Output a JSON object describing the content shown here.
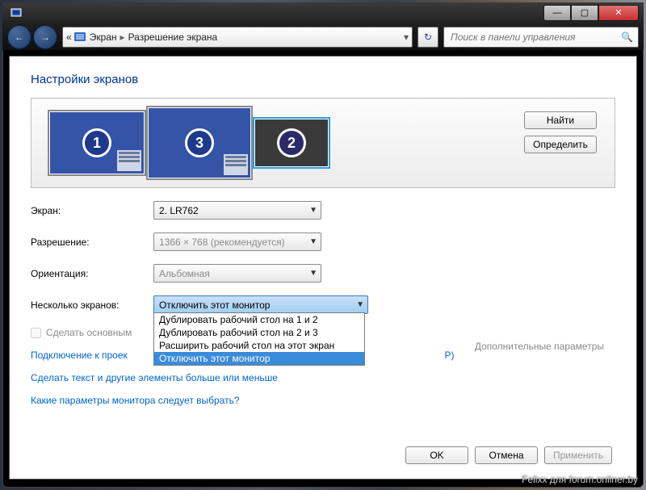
{
  "titlebar": {
    "min": "—",
    "max": "▢",
    "close": "✕"
  },
  "nav": {
    "back_glyph": "←",
    "fwd_glyph": "→",
    "overflow": "«",
    "crumb1": "Экран",
    "crumb2": "Разрешение экрана",
    "sep": "▸",
    "refresh": "↻",
    "search_placeholder": "Поиск в панели управления",
    "search_icon": "🔍"
  },
  "heading": "Настройки экранов",
  "preview": {
    "monitors": [
      {
        "num": "1",
        "w": 118,
        "h": 78,
        "selected": false,
        "off": false
      },
      {
        "num": "3",
        "w": 128,
        "h": 88,
        "selected": false,
        "off": false
      },
      {
        "num": "2",
        "w": 92,
        "h": 60,
        "selected": true,
        "off": true
      }
    ],
    "find": "Найти",
    "identify": "Определить"
  },
  "rows": {
    "screen_lbl": "Экран:",
    "screen_val": "2. LR762",
    "res_lbl": "Разрешение:",
    "res_val": "1366 × 768 (рекомендуется)",
    "orient_lbl": "Ориентация:",
    "orient_val": "Альбомная",
    "multi_lbl": "Несколько экранов:",
    "multi_val": "Отключить этот монитор",
    "multi_options": [
      "Дублировать рабочий стол на 1 и 2",
      "Дублировать рабочий стол на 2 и 3",
      "Расширить рабочий стол на этот экран",
      "Отключить этот монитор"
    ]
  },
  "primary_chk": "Сделать основным",
  "adv_link": "Дополнительные параметры",
  "link1": "Подключение к проек",
  "link1_tail": " P)",
  "link2": "Сделать текст и другие элементы больше или меньше",
  "link3": "Какие параметры монитора следует выбрать?",
  "buttons": {
    "ok": "OK",
    "cancel": "Отмена",
    "apply": "Применить"
  },
  "watermark": "Felixx для forum.onliner.by"
}
